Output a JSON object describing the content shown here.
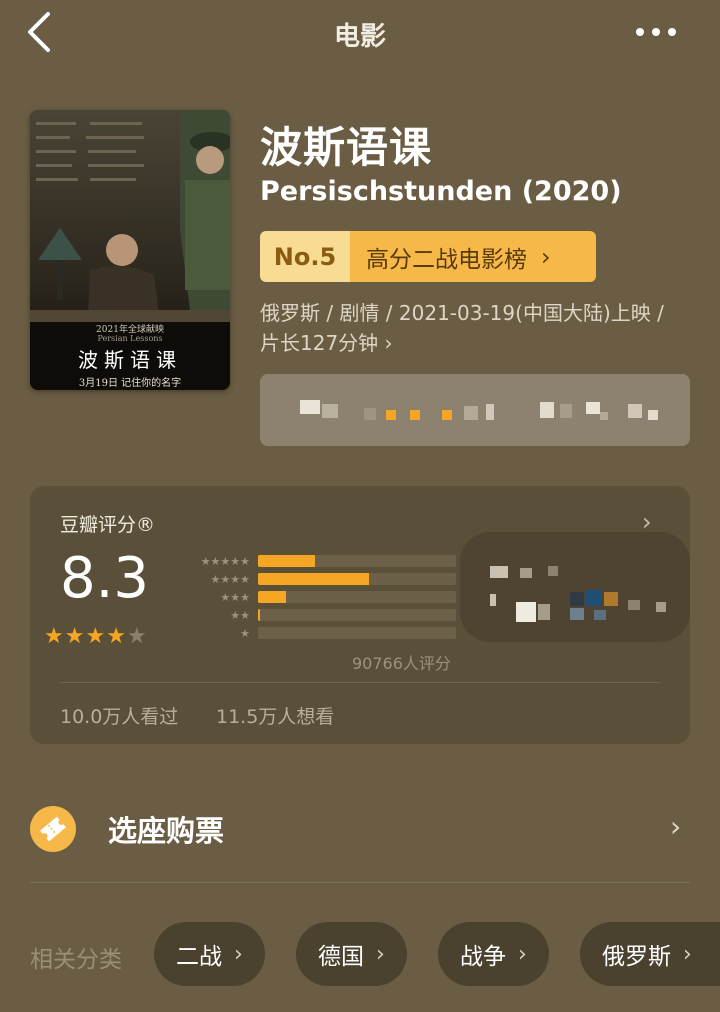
{
  "nav": {
    "title": "电影"
  },
  "poster": {
    "title_text": "波斯语课",
    "tagline": "2021年全球献映",
    "subtitle": "Persian Lessons",
    "date_text": "3月19日 记住你的名字"
  },
  "movie": {
    "title": "波斯语课",
    "original_title": "Persischstunden (2020)",
    "rank_no": "No.5",
    "rank_list": "高分二战电影榜",
    "meta": "俄罗斯 / 剧情 / 2021-03-19(中国大陆)上映 / 片长127分钟",
    "meta_arrow": "›"
  },
  "rating": {
    "label": "豆瓣评分®",
    "score": "8.3",
    "stars": {
      "filled": 4,
      "total": 5
    },
    "distribution": [
      {
        "stars": "★★★★★",
        "fraction": 0.29
      },
      {
        "stars": "★★★★",
        "fraction": 0.56
      },
      {
        "stars": "★★★",
        "fraction": 0.14
      },
      {
        "stars": "★★",
        "fraction": 0.01
      },
      {
        "stars": "★",
        "fraction": 0.0
      }
    ],
    "count_text": "90766人评分",
    "watched": "10.0万人看过",
    "wishes": "11.5万人想看"
  },
  "ticket": {
    "label": "选座购票",
    "arrow": "›"
  },
  "categories": {
    "label": "相关分类",
    "tags": [
      {
        "label": "二战"
      },
      {
        "label": "德国"
      },
      {
        "label": "战争"
      },
      {
        "label": "俄罗斯"
      }
    ],
    "chevron": "›"
  },
  "colors": {
    "accent": "#f5a623",
    "background": "#6a5d43",
    "card": "#5a4f38"
  }
}
